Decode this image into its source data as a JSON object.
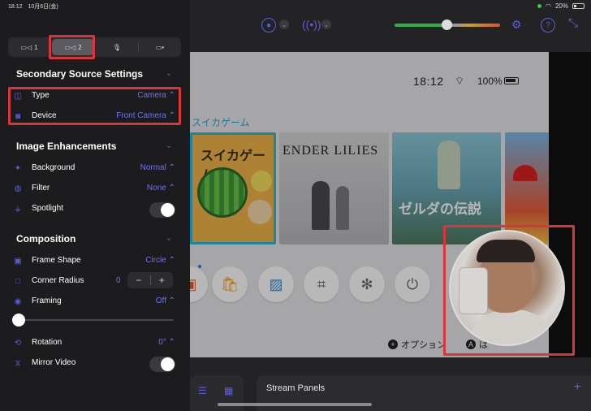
{
  "status": {
    "time": "18:12",
    "date": "10月6日(金)",
    "battery": "20%"
  },
  "tabs": [
    {
      "label": "1",
      "icon": "camera-icon"
    },
    {
      "label": "2",
      "icon": "camera-icon",
      "selected": true
    },
    {
      "label": "",
      "icon": "microphone-icon"
    },
    {
      "label": "",
      "icon": "screen-icon"
    }
  ],
  "secondary": {
    "title": "Secondary Source Settings",
    "type_label": "Type",
    "type_value": "Camera ⌃",
    "device_label": "Device",
    "device_value": "Front Camera ⌃"
  },
  "image": {
    "title": "Image Enhancements",
    "background_label": "Background",
    "background_value": "Normal ⌃",
    "filter_label": "Filter",
    "filter_value": "None ⌃",
    "spotlight_label": "Spotlight",
    "spotlight_on": false
  },
  "composition": {
    "title": "Composition",
    "frame_shape_label": "Frame Shape",
    "frame_shape_value": "Circle ⌃",
    "corner_radius_label": "Corner Radius",
    "corner_radius_value": "0",
    "framing_label": "Framing",
    "framing_value": "Off ⌃",
    "framing_slider": 0,
    "rotation_label": "Rotation",
    "rotation_value": "0° ⌃",
    "mirror_label": "Mirror Video",
    "mirror_on": false
  },
  "switch_screen": {
    "time": "18:12",
    "battery": "100%",
    "selected_game": "スイカゲーム",
    "games": [
      "スイカゲーム",
      "ENDER LILIES",
      "ゼルダの伝説",
      ""
    ],
    "options_label": "オプション",
    "a_label": "は"
  },
  "bottom": {
    "stream_panels_label": "Stream Panels"
  },
  "colors": {
    "accent": "#5a5fd8",
    "highlight": "#d8363a"
  }
}
